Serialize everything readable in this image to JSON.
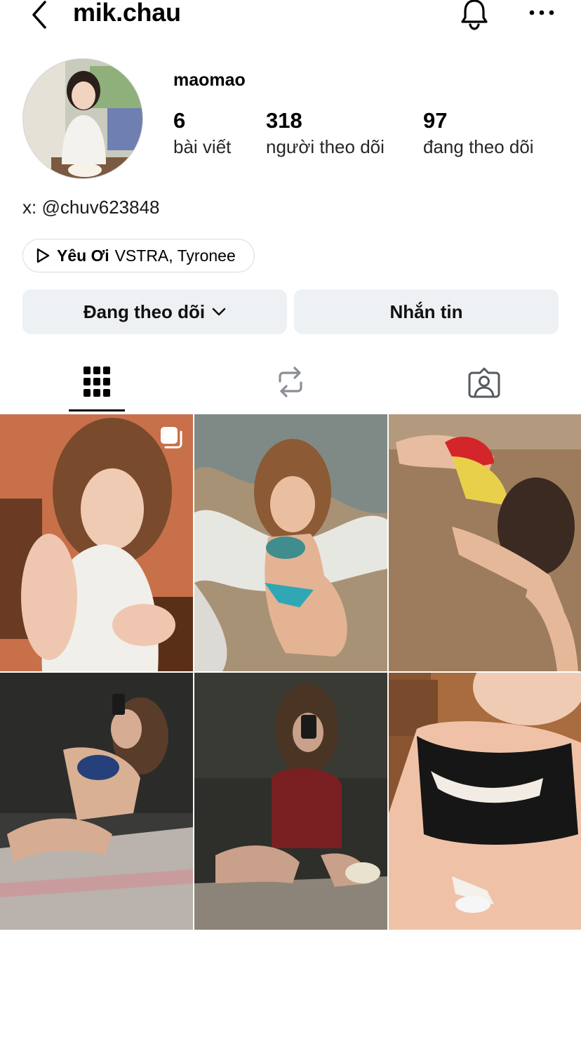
{
  "header": {
    "username": "mik.chau",
    "back_icon": "chevron-left-icon",
    "bell_icon": "bell-icon",
    "more_icon": "more-horizontal-icon"
  },
  "profile": {
    "display_name": "maomao",
    "stats": [
      {
        "value": "6",
        "label": "bài viết"
      },
      {
        "value": "318",
        "label": "người theo dõi"
      },
      {
        "value": "97",
        "label": "đang theo dõi"
      }
    ],
    "bio": "x: @chuv623848",
    "music": {
      "song": "Yêu Ơi",
      "artists": "VSTRA, Tyronee"
    }
  },
  "actions": {
    "follow_label": "Đang theo dõi",
    "message_label": "Nhắn tin"
  },
  "tabs": [
    {
      "name": "posts",
      "icon": "grid-icon",
      "active": true
    },
    {
      "name": "reposts",
      "icon": "repost-icon",
      "active": false
    },
    {
      "name": "tagged",
      "icon": "tagged-person-icon",
      "active": false
    }
  ],
  "posts": [
    {
      "alt": "photo-1",
      "multiple": true
    },
    {
      "alt": "photo-2",
      "multiple": false
    },
    {
      "alt": "photo-3",
      "multiple": false
    },
    {
      "alt": "photo-4",
      "multiple": false
    },
    {
      "alt": "photo-5",
      "multiple": false
    },
    {
      "alt": "photo-6",
      "multiple": false
    }
  ]
}
